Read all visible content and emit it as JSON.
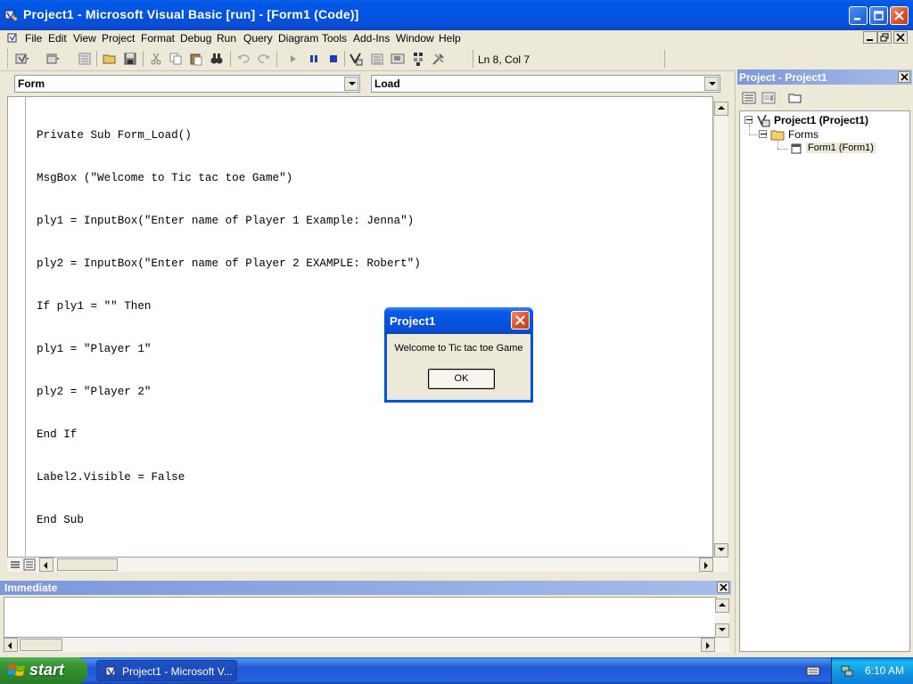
{
  "window": {
    "title": "Project1 - Microsoft Visual Basic [run] - [Form1 (Code)]"
  },
  "menu": {
    "items": [
      "File",
      "Edit",
      "View",
      "Project",
      "Format",
      "Debug",
      "Run",
      "Query",
      "Diagram",
      "Tools",
      "Add-Ins",
      "Window",
      "Help"
    ]
  },
  "toolbar": {
    "status": "Ln 8, Col 7"
  },
  "code_window": {
    "object_combo": "Form",
    "procedure_combo": "Load",
    "lines": [
      "Private Sub Form_Load()",
      "MsgBox (\"Welcome to Tic tac toe Game\")",
      "ply1 = InputBox(\"Enter name of Player 1 Example: Jenna\")",
      "ply2 = InputBox(\"Enter name of Player 2 EXAMPLE: Robert\")",
      "If ply1 = \"\" Then",
      "ply1 = \"Player 1\"",
      "ply2 = \"Player 2\"",
      "End If",
      "Label2.Visible = False",
      "End Sub"
    ]
  },
  "immediate": {
    "title": "Immediate"
  },
  "project_explorer": {
    "title": "Project - Project1",
    "tree": {
      "project": "Project1 (Project1)",
      "folder": "Forms",
      "form": "Form1 (Form1)"
    }
  },
  "msgbox": {
    "title": "Project1",
    "message": "Welcome to Tic tac toe Game",
    "ok_label": "OK"
  },
  "taskbar": {
    "start_label": "start",
    "task_label": "Project1 - Microsoft V...",
    "clock": "6:10 AM"
  }
}
